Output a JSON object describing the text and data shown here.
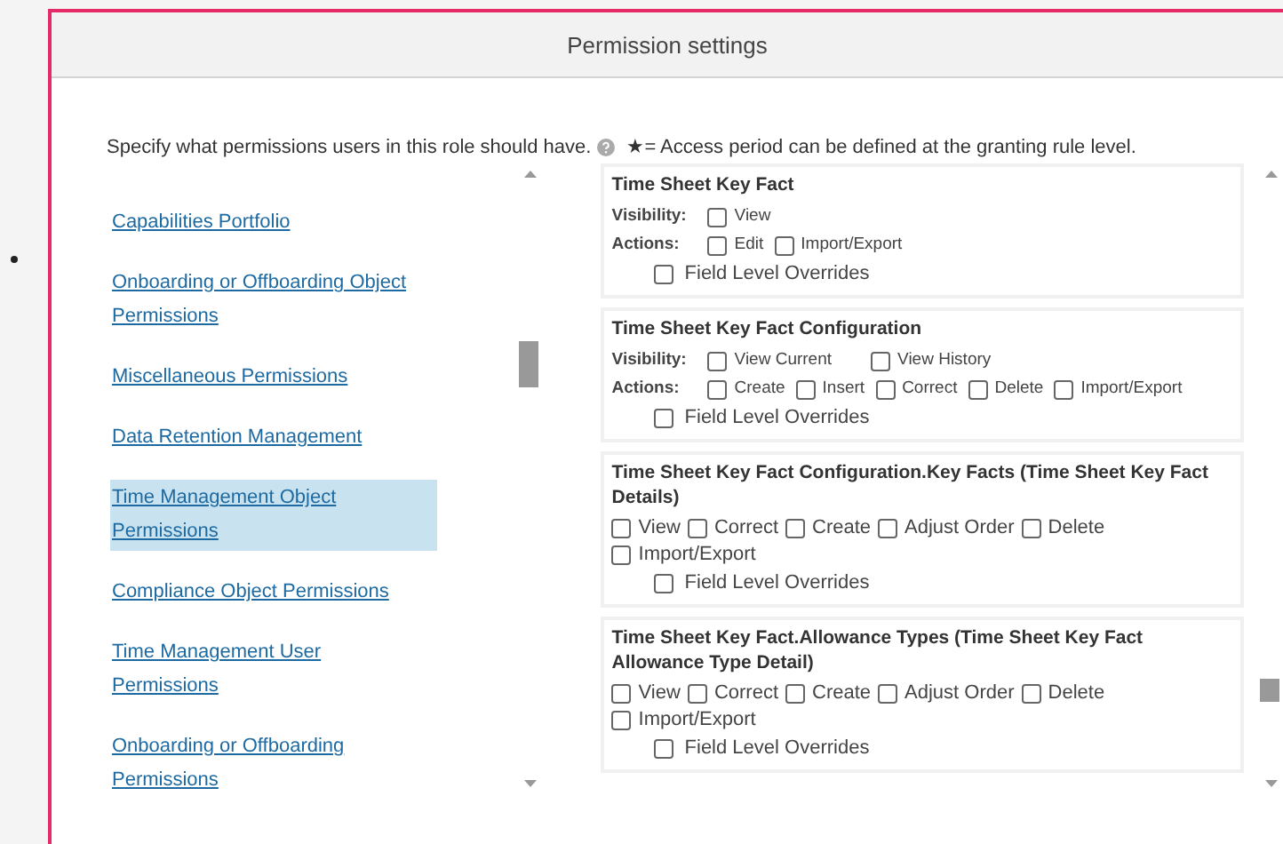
{
  "dialog": {
    "title": "Permission settings",
    "description": "Specify what permissions users in this role should have.",
    "legend": "★= Access period can be defined at the granting rule level."
  },
  "categories": [
    {
      "label": "Capabilities Portfolio",
      "selected": false
    },
    {
      "label": "Onboarding or Offboarding Object Permissions",
      "selected": false
    },
    {
      "label": "Miscellaneous Permissions",
      "selected": false
    },
    {
      "label": "Data Retention Management",
      "selected": false
    },
    {
      "label": "Time Management Object Permissions",
      "selected": true
    },
    {
      "label": "Compliance Object Permissions",
      "selected": false
    },
    {
      "label": "Time Management User Permissions",
      "selected": false
    },
    {
      "label": "Onboarding or Offboarding Permissions",
      "selected": false
    }
  ],
  "sections": [
    {
      "kind": "grouped",
      "title": "Time Sheet Key Fact",
      "groups": [
        {
          "label": "Visibility:",
          "options": [
            {
              "label": "View",
              "checked": false
            }
          ]
        },
        {
          "label": "Actions:",
          "options": [
            {
              "label": "Edit",
              "checked": false
            },
            {
              "label": "Import/Export",
              "checked": false
            }
          ]
        }
      ],
      "override": {
        "label": "Field Level Overrides",
        "checked": false
      }
    },
    {
      "kind": "grouped",
      "title": "Time Sheet Key Fact Configuration",
      "groups": [
        {
          "label": "Visibility:",
          "options": [
            {
              "label": "View Current",
              "checked": false
            },
            {
              "label": "View History",
              "checked": false
            }
          ]
        },
        {
          "label": "Actions:",
          "options": [
            {
              "label": "Create",
              "checked": false
            },
            {
              "label": "Insert",
              "checked": false
            },
            {
              "label": "Correct",
              "checked": false
            },
            {
              "label": "Delete",
              "checked": false
            },
            {
              "label": "Import/Export",
              "checked": false
            }
          ]
        }
      ],
      "override": {
        "label": "Field Level Overrides",
        "checked": false
      }
    },
    {
      "kind": "flat",
      "title": "Time Sheet Key Fact Configuration.Key Facts (Time Sheet Key Fact Details)",
      "options": [
        {
          "label": "View",
          "checked": false
        },
        {
          "label": "Correct",
          "checked": false
        },
        {
          "label": "Create",
          "checked": false
        },
        {
          "label": "Adjust Order",
          "checked": false
        },
        {
          "label": "Delete",
          "checked": false
        },
        {
          "label": "Import/Export",
          "checked": false
        }
      ],
      "override": {
        "label": "Field Level Overrides",
        "checked": false
      }
    },
    {
      "kind": "flat",
      "title": "Time Sheet Key Fact.Allowance Types (Time Sheet Key Fact Allowance Type Detail)",
      "options": [
        {
          "label": "View",
          "checked": false
        },
        {
          "label": "Correct",
          "checked": false
        },
        {
          "label": "Create",
          "checked": false
        },
        {
          "label": "Adjust Order",
          "checked": false
        },
        {
          "label": "Delete",
          "checked": false
        },
        {
          "label": "Import/Export",
          "checked": false
        }
      ],
      "override": {
        "label": "Field Level Overrides",
        "checked": false
      }
    }
  ]
}
